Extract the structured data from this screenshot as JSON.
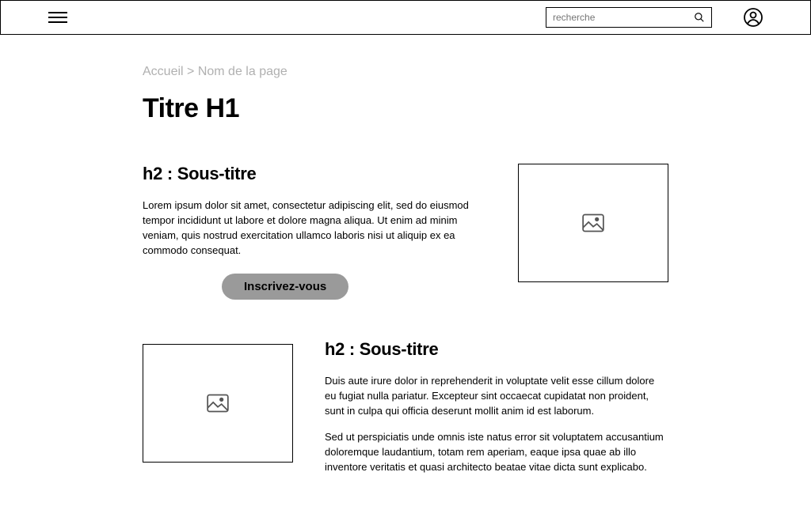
{
  "search": {
    "placeholder": "recherche"
  },
  "breadcrumb": {
    "home": "Accueil",
    "separator": ">",
    "current": "Nom de la page"
  },
  "page": {
    "title": "Titre H1"
  },
  "section1": {
    "heading": "h2 : Sous-titre",
    "body": "Lorem ipsum dolor sit amet, consectetur adipiscing elit, sed do eiusmod tempor incididunt ut labore et dolore magna aliqua. Ut enim ad minim veniam, quis nostrud exercitation ullamco laboris nisi ut aliquip ex ea commodo consequat.",
    "cta": "Inscrivez-vous"
  },
  "section2": {
    "heading": "h2 : Sous-titre",
    "body1": "Duis aute irure dolor in reprehenderit in voluptate velit esse cillum dolore eu fugiat nulla pariatur. Excepteur sint occaecat cupidatat non proident, sunt in culpa qui officia deserunt mollit anim id est laborum.",
    "body2": "Sed ut perspiciatis unde omnis iste natus error sit voluptatem accusantium doloremque laudantium, totam rem aperiam, eaque ipsa quae ab illo inventore veritatis et quasi architecto beatae vitae dicta sunt explicabo."
  }
}
